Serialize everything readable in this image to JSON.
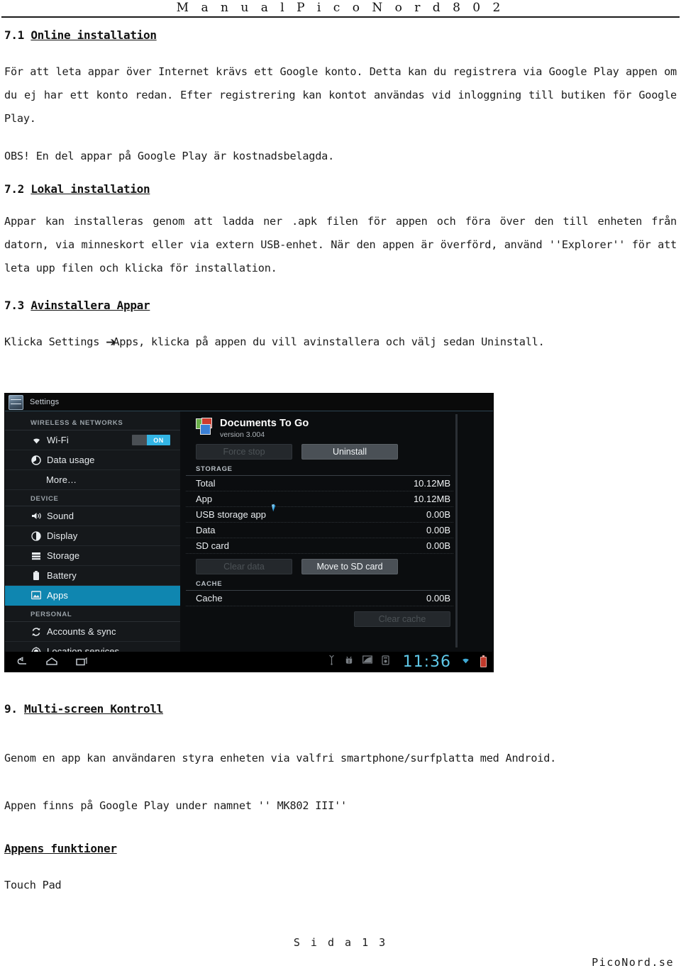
{
  "header": {
    "title": "M a n u a l   P i c o N o r d   8 0 2"
  },
  "sections": {
    "s71": {
      "num": "7.1 ",
      "title": "Online installation",
      "p1": "För att leta appar över Internet krävs ett Google konto. Detta kan du registrera via Google Play appen om du ej har ett konto redan. Efter registrering kan kontot användas vid inloggning till butiken för Google Play.",
      "p2": "OBS! En del appar på Google Play är kostnadsbelagda."
    },
    "s72": {
      "num": "7.2 ",
      "title": "Lokal installation",
      "p1": "Appar kan installeras genom att ladda ner .apk filen för appen och föra över den till enheten från datorn, via minneskort eller via extern USB-enhet. När den appen är överförd, använd ''Explorer'' för att leta upp filen och klicka för installation."
    },
    "s73": {
      "num": "7.3 ",
      "title": "Avinstallera Appar",
      "p1_before": "Klicka Settings ",
      "p1_arrow": "➔",
      "p1_after": "Apps, klicka på appen du vill avinstallera och välj sedan Uninstall."
    },
    "s9": {
      "num": "9. ",
      "title": "Multi-screen Kontroll",
      "p1": "Genom en app kan användaren styra enheten via valfri smartphone/surfplatta med Android.",
      "p2": "Appen finns på Google Play under namnet '' MK802 III''"
    },
    "s_funktioner": {
      "title": "Appens funktioner",
      "p1": "Touch Pad"
    }
  },
  "screenshot": {
    "titlebar": {
      "app_icon": "settings-sliders-icon",
      "label": "Settings"
    },
    "sidebar": [
      {
        "type": "group",
        "label": "WIRELESS & NETWORKS"
      },
      {
        "type": "item",
        "icon": "wifi-icon",
        "label": "Wi-Fi",
        "toggle": "ON",
        "selected": false
      },
      {
        "type": "item",
        "icon": "data-usage-icon",
        "label": "Data usage",
        "selected": false
      },
      {
        "type": "item",
        "icon": "",
        "label": "More…",
        "selected": false
      },
      {
        "type": "group",
        "label": "DEVICE"
      },
      {
        "type": "item",
        "icon": "sound-icon",
        "label": "Sound",
        "selected": false
      },
      {
        "type": "item",
        "icon": "display-icon",
        "label": "Display",
        "selected": false
      },
      {
        "type": "item",
        "icon": "storage-icon",
        "label": "Storage",
        "selected": false
      },
      {
        "type": "item",
        "icon": "battery-icon",
        "label": "Battery",
        "selected": false
      },
      {
        "type": "item",
        "icon": "apps-icon",
        "label": "Apps",
        "selected": true
      },
      {
        "type": "group",
        "label": "PERSONAL"
      },
      {
        "type": "item",
        "icon": "sync-icon",
        "label": "Accounts & sync",
        "selected": false
      },
      {
        "type": "item",
        "icon": "location-icon",
        "label": "Location services",
        "selected": false
      }
    ],
    "detail": {
      "app_icon": "documents-to-go-icon",
      "app_name": "Documents To Go",
      "app_version": "version 3.004",
      "buttons_top": [
        {
          "label": "Force stop",
          "enabled": false
        },
        {
          "label": "Uninstall",
          "enabled": true
        }
      ],
      "storage_label": "STORAGE",
      "storage_rows": [
        {
          "key": "Total",
          "value": "10.12MB"
        },
        {
          "key": "App",
          "value": "10.12MB"
        },
        {
          "key": "USB storage app",
          "value": "0.00B"
        },
        {
          "key": "Data",
          "value": "0.00B"
        },
        {
          "key": "SD card",
          "value": "0.00B"
        }
      ],
      "buttons_mid": [
        {
          "label": "Clear data",
          "enabled": false
        },
        {
          "label": "Move to SD card",
          "enabled": true
        }
      ],
      "cache_label": "CACHE",
      "cache_rows": [
        {
          "key": "Cache",
          "value": "0.00B"
        }
      ],
      "buttons_bottom": [
        {
          "label": "Clear cache",
          "enabled": false
        }
      ]
    },
    "navbar": {
      "back": "back-icon",
      "home": "home-icon",
      "recents": "recent-apps-icon",
      "status_icons": [
        "usb-icon",
        "adb-icon",
        "notification-icon",
        "sdcard-icon"
      ],
      "clock": "11:36",
      "wifi": "wifi-status-icon",
      "battery": "battery-status-icon"
    },
    "colors": {
      "accent": "#0f86b0",
      "toggle_on": "#33b5e5",
      "clock": "#5fc8e8",
      "battery": "#c0392b"
    }
  },
  "footer": {
    "page": "S i d a  1 3",
    "site": "PicoNord.se"
  }
}
